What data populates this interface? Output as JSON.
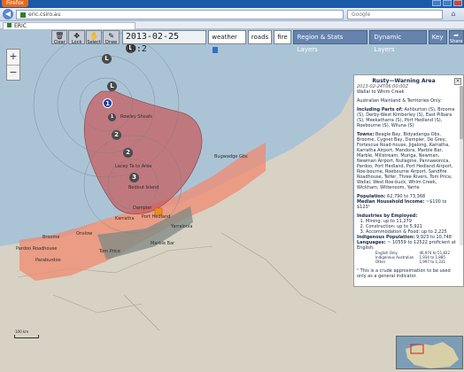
{
  "browser": {
    "app_button": "Firefox",
    "url": "eric.csiro.au",
    "search_placeholder": "Google",
    "tab_title": "ERIC"
  },
  "toolbar": {
    "tools": [
      {
        "label": "Clear",
        "icon": "trash-icon"
      },
      {
        "label": "Lock",
        "icon": "move-icon"
      },
      {
        "label": "Select",
        "icon": "hand-icon"
      },
      {
        "label": "Draw",
        "icon": "pencil-icon"
      }
    ],
    "date": "2013-02-25 10:2",
    "chips": [
      {
        "label": "weather"
      },
      {
        "label": "roads"
      },
      {
        "label": "fire"
      }
    ],
    "layer_buttons": [
      {
        "label": "Region & Stats Layers"
      },
      {
        "label": "Dynamic Layers"
      },
      {
        "label": "Key"
      }
    ],
    "share_label": "Share"
  },
  "zoom": {
    "in": "+",
    "out": "−"
  },
  "storms": [
    {
      "label": "L"
    },
    {
      "label": "L"
    },
    {
      "label": "1"
    },
    {
      "label": "1"
    },
    {
      "label": "2"
    },
    {
      "label": "2"
    },
    {
      "label": "3"
    }
  ],
  "places": [
    {
      "label": "Rowley Shoals"
    },
    {
      "label": "Broome"
    },
    {
      "label": "Lacey Ta to Area"
    },
    {
      "label": "Bedout Island"
    },
    {
      "label": "Bugwadge Gbs"
    },
    {
      "label": "Port Hedland"
    },
    {
      "label": "Dampier"
    },
    {
      "label": "Karratha"
    },
    {
      "label": "Marble Bar"
    },
    {
      "label": "Onslow"
    },
    {
      "label": "Pardoo Roadhouse"
    },
    {
      "label": "Paraburdoo"
    },
    {
      "label": "Tom Price"
    },
    {
      "label": "Yarraloola"
    }
  ],
  "scale": "100 km",
  "colors": {
    "cone_fill": "#d9625e",
    "warning_band": "#f08a6f",
    "selected_track": "#1f3c9e",
    "water": "#aac4d6",
    "land": "#d8d2c4"
  },
  "panel": {
    "title": "Rusty—Warning Area",
    "timestamp": "2013-02-24T06:00:00Z",
    "area": "Wallal to Whim Creek",
    "region": "Australian Mainland & Territories Only:",
    "including_label": "Including Parts of:",
    "including": "Ashburton (S), Broome (S), Derby-West Kimberley (S), East Pilbara (S), Meekatharra (S), Port Hedland (S), Roebourne (S), Wiluna (S)",
    "towns_label": "Towns:",
    "towns": "Beagle Bay, Bidyadanga Obs, Broome, Cygnet Bay, Dampier, De Grey, Fortescue Road-house, Jigalong, Karratha, Karratha Airport, Mandora, Marble Bar, Marble, Millstream, Muriga, Newman, Newman Airport, Nullagine, Pannawonica, Pardoo, Port Hedland, Port Hedland Airport, Roe-bourne, Roebourne Airport, Sandfire Roadhouse, Telfer, Three Rivers, Tom Price, Wallal, West Roe-buck, Whim Creek, Wickham, Wittenoom, Yarrie",
    "population_label": "Population:",
    "population": "62,790 to 73,368",
    "income_label": "Median Household Income:",
    "income": "~$100 to $123¹",
    "industries_label": "Industries by Employed:",
    "industries": [
      "Mining: up to 11,279",
      "Construction: up to 5,921",
      "Accommodation & Food: up to 2,225"
    ],
    "indigenous_label": "Indigenous Population:",
    "indigenous": "9,923 to 10,748",
    "languages_label": "Languages:",
    "languages": "~ 10559 to 12522 proficient at English:",
    "lang_table": [
      {
        "lang": "English Only",
        "value": "46,974 to 51,822"
      },
      {
        "lang": "Indigenous Australian",
        "value": "1,934 to 1,885"
      },
      {
        "lang": "Other",
        "value": "1,997 to 1,331"
      }
    ],
    "note": "¹ This is a crude approximation to be used only as a general indicator."
  }
}
